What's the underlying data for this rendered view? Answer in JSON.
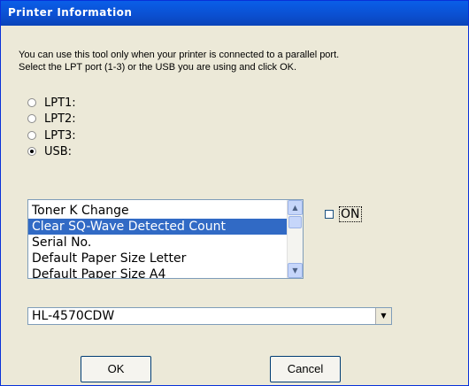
{
  "window": {
    "title": "Printer Information"
  },
  "description": {
    "line1": "You can use this tool only when your printer is connected to a parallel port.",
    "line2": "Select the LPT port (1-3) or the USB you are using and click OK."
  },
  "ports": [
    {
      "label": "LPT1:",
      "selected": false
    },
    {
      "label": "LPT2:",
      "selected": false
    },
    {
      "label": "LPT3:",
      "selected": false
    },
    {
      "label": "USB:",
      "selected": true
    }
  ],
  "info_list": {
    "items": [
      "Toner K Change",
      "Clear SQ-Wave Detected Count",
      "Serial No.",
      "Default Paper Size Letter",
      "Default Paper Size A4"
    ],
    "selected_index": 1
  },
  "on_checkbox": {
    "label": "ON",
    "checked": false
  },
  "model_select": {
    "value": "HL-4570CDW"
  },
  "buttons": {
    "ok": "OK",
    "cancel": "Cancel"
  },
  "colors": {
    "titlebar": "#0b4fd0",
    "selection": "#316ac5",
    "dialog_bg": "#ece9d8"
  }
}
